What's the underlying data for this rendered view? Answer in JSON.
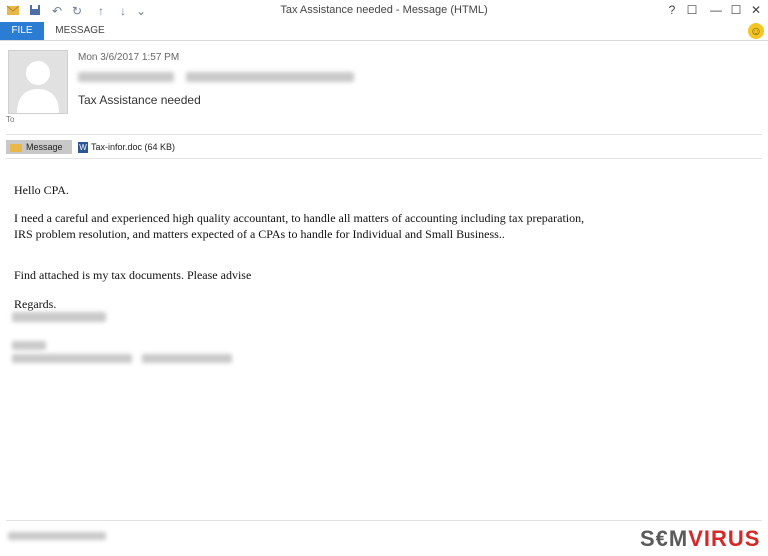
{
  "window": {
    "title": "Tax Assistance needed - Message (HTML)",
    "help": "?",
    "minimize": "—",
    "maximize": "☐",
    "close": "✕"
  },
  "quick_access": {
    "save_icon": "save-icon",
    "undo": "↶",
    "redo": "↻",
    "up": "↑",
    "down": "↓",
    "more": "⌄"
  },
  "ribbon": {
    "tabs": [
      "FILE",
      "MESSAGE"
    ],
    "smiley": "☺"
  },
  "header": {
    "date": "Mon 3/6/2017 1:57 PM",
    "subject": "Tax Assistance needed",
    "to_label": "To"
  },
  "attachments": {
    "message_tab": "Message",
    "file_name": "Tax-infor.doc (64 KB)"
  },
  "body": {
    "greeting": "Hello CPA.",
    "para1_line1": "I need a careful and experienced high quality accountant, to handle all matters of accounting including tax preparation,",
    "para1_line2": "IRS problem resolution, and matters expected of a CPAs to handle for Individual and Small Business..",
    "para2": "Find attached is my tax documents. Please advise",
    "closing": "Regards."
  },
  "watermark": {
    "part1": "S€M",
    "part2": "VIRUS"
  },
  "colors": {
    "accent": "#2b7cd3",
    "brand_red": "#d62828"
  }
}
